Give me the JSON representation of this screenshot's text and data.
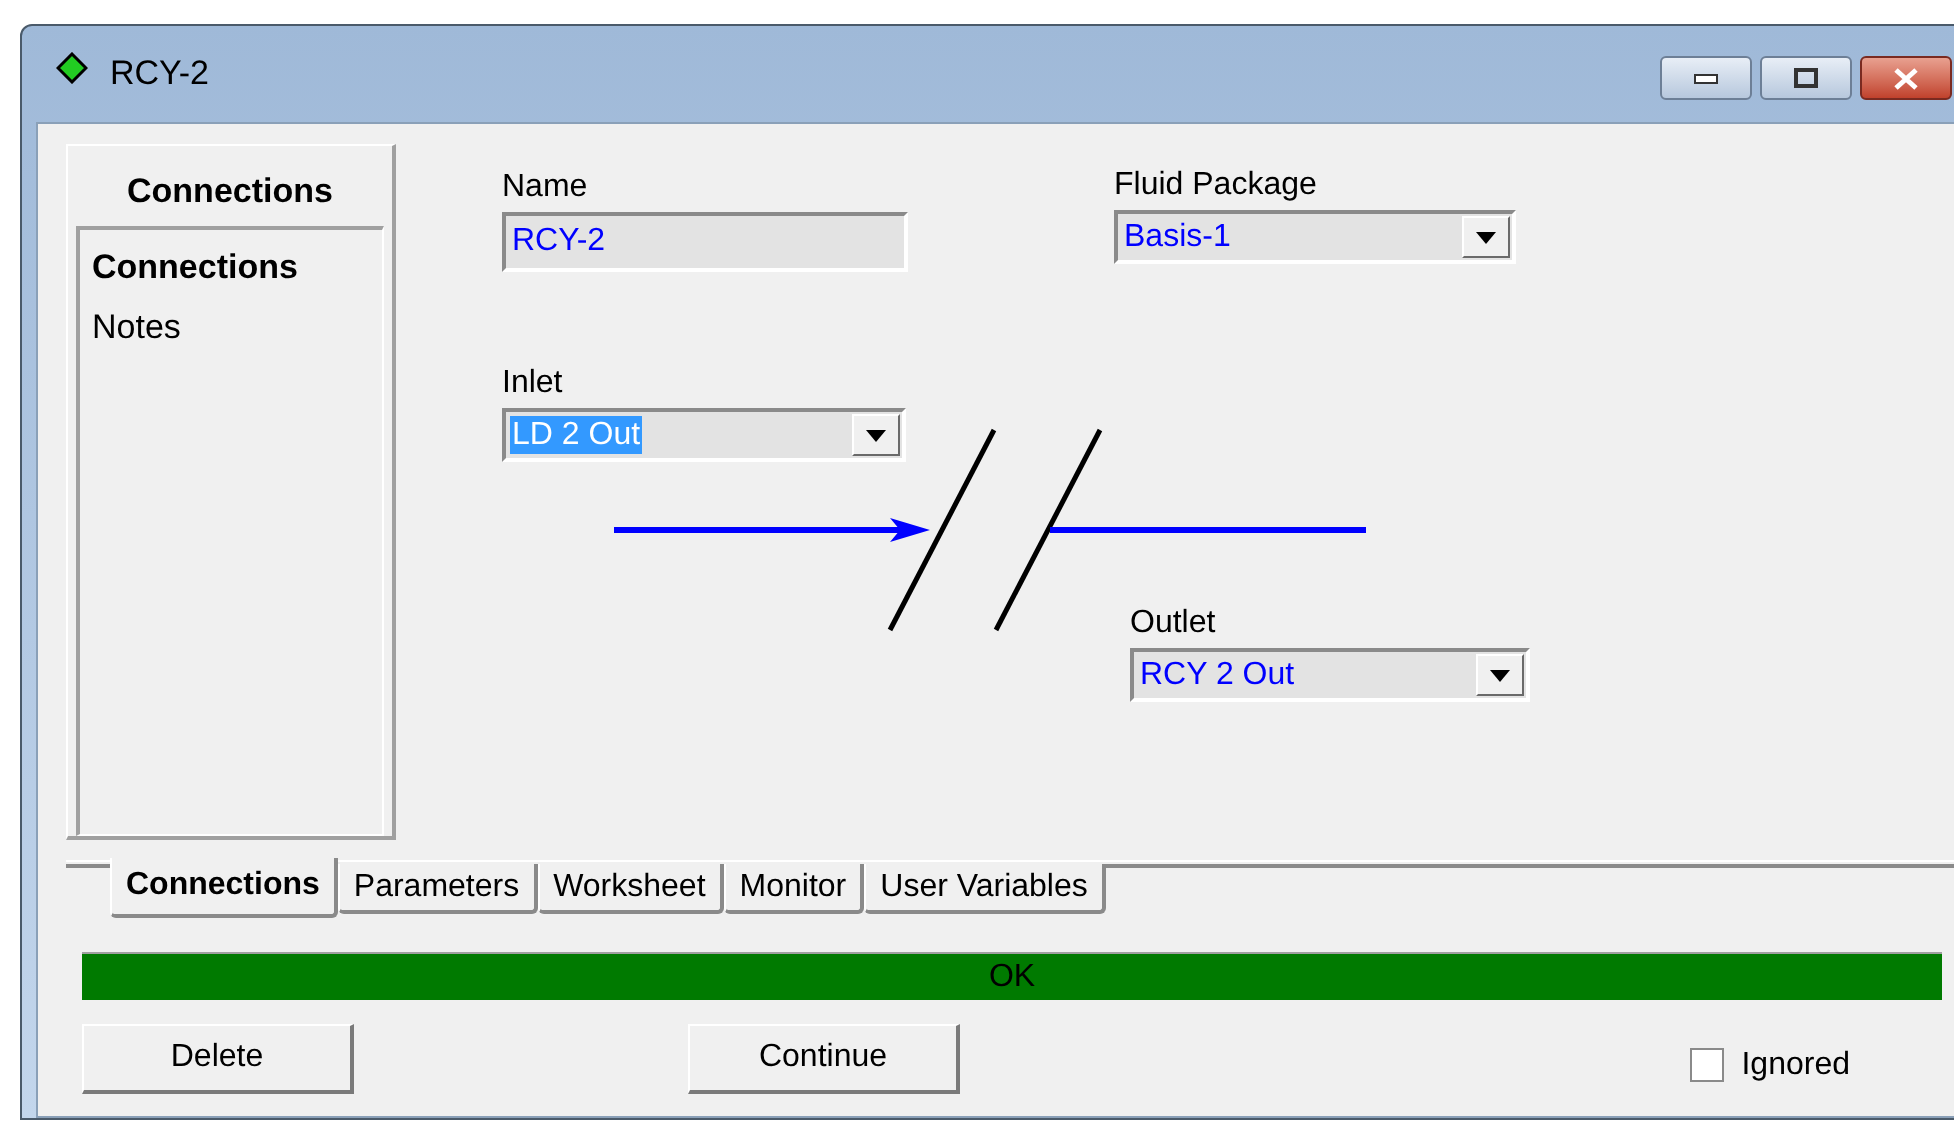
{
  "window": {
    "title": "RCY-2"
  },
  "sidebar": {
    "header": "Connections",
    "items": [
      {
        "label": "Connections",
        "selected": true
      },
      {
        "label": "Notes",
        "selected": false
      }
    ]
  },
  "fields": {
    "name": {
      "label": "Name",
      "value": "RCY-2"
    },
    "fluid_package": {
      "label": "Fluid Package",
      "value": "Basis-1"
    },
    "inlet": {
      "label": "Inlet",
      "value": "LD 2 Out",
      "text_selected": true
    },
    "outlet": {
      "label": "Outlet",
      "value": "RCY 2 Out",
      "text_selected": false
    }
  },
  "tabs": [
    {
      "label": "Connections",
      "selected": true
    },
    {
      "label": "Parameters",
      "selected": false
    },
    {
      "label": "Worksheet",
      "selected": false
    },
    {
      "label": "Monitor",
      "selected": false
    },
    {
      "label": "User Variables",
      "selected": false
    }
  ],
  "status": {
    "text": "OK"
  },
  "buttons": [
    "Delete",
    "Continue"
  ],
  "ignored": {
    "label": "Ignored",
    "checked": false
  }
}
